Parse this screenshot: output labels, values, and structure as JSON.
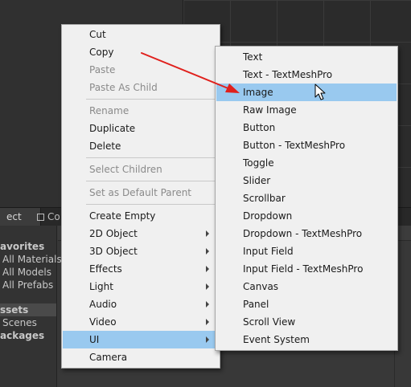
{
  "bottom_tabs": {
    "project": "ect",
    "console": "Co"
  },
  "project_tree": {
    "favorites": "avorites",
    "all_materials": "All Materials",
    "all_models": "All Models",
    "all_prefabs": "All Prefabs",
    "assets": "ssets",
    "scenes": "Scenes",
    "packages": "ackages"
  },
  "context_menu": {
    "cut": "Cut",
    "copy": "Copy",
    "paste": "Paste",
    "paste_as_child": "Paste As Child",
    "rename": "Rename",
    "duplicate": "Duplicate",
    "delete": "Delete",
    "select_children": "Select Children",
    "set_default_parent": "Set as Default Parent",
    "create_empty": "Create Empty",
    "object_2d": "2D Object",
    "object_3d": "3D Object",
    "effects": "Effects",
    "light": "Light",
    "audio": "Audio",
    "video": "Video",
    "ui": "UI",
    "camera": "Camera"
  },
  "ui_submenu": {
    "text": "Text",
    "text_tmp": "Text - TextMeshPro",
    "image": "Image",
    "raw_image": "Raw Image",
    "button": "Button",
    "button_tmp": "Button - TextMeshPro",
    "toggle": "Toggle",
    "slider": "Slider",
    "scrollbar": "Scrollbar",
    "dropdown": "Dropdown",
    "dropdown_tmp": "Dropdown - TextMeshPro",
    "input_field": "Input Field",
    "input_field_tmp": "Input Field - TextMeshPro",
    "canvas": "Canvas",
    "panel": "Panel",
    "scroll_view": "Scroll View",
    "event_system": "Event System"
  },
  "colors": {
    "menu_bg": "#f0f0f0",
    "highlight": "#99c9ef",
    "disabled_text": "#8a8a8a",
    "annotation_arrow": "#e0201c",
    "editor_bg": "#383838"
  },
  "icons": [
    "submenu-arrow-icon",
    "mouse-cursor-icon",
    "annotation-arrow-icon",
    "console-icon"
  ]
}
